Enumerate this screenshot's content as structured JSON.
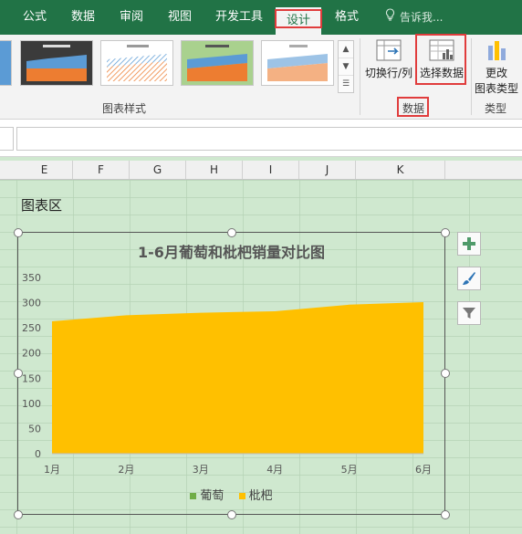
{
  "ribbon_tabs": [
    {
      "label": "公式",
      "active": false
    },
    {
      "label": "数据",
      "active": false
    },
    {
      "label": "审阅",
      "active": false
    },
    {
      "label": "视图",
      "active": false
    },
    {
      "label": "开发工具",
      "active": false
    },
    {
      "label": "设计",
      "active": true
    },
    {
      "label": "格式",
      "active": false
    }
  ],
  "tell_me": "告诉我...",
  "ribbon": {
    "chart_styles_label": "图表样式",
    "switch_row_col": "切换行/列",
    "select_data": "选择数据",
    "data_group_label": "数据",
    "change_type_line1": "更改",
    "change_type_line2": "图表类型",
    "type_group_label": "类型"
  },
  "columns": [
    "E",
    "F",
    "G",
    "H",
    "I",
    "J",
    "K"
  ],
  "sheet_label": "图表区",
  "colors": {
    "accent": "#217346",
    "grape": "#70ad47",
    "loquat": "#ffc000",
    "highlight": "#e03c3c"
  },
  "icons": {
    "add": "plus-icon",
    "style": "brush-icon",
    "filter": "filter-icon",
    "tell_me": "lightbulb-icon"
  },
  "chart_data": {
    "type": "area",
    "title": "1-6月葡萄和枇杷销量对比图",
    "categories": [
      "1月",
      "2月",
      "3月",
      "4月",
      "5月",
      "6月"
    ],
    "series": [
      {
        "name": "葡萄",
        "values": [
          0,
          0,
          0,
          0,
          0,
          0
        ]
      },
      {
        "name": "枇杷",
        "values": [
          263,
          275,
          280,
          283,
          296,
          301
        ]
      }
    ],
    "ylim": [
      0,
      350
    ],
    "yticks": [
      0,
      50,
      100,
      150,
      200,
      250,
      300,
      350
    ],
    "grid": false,
    "legend_position": "bottom"
  }
}
